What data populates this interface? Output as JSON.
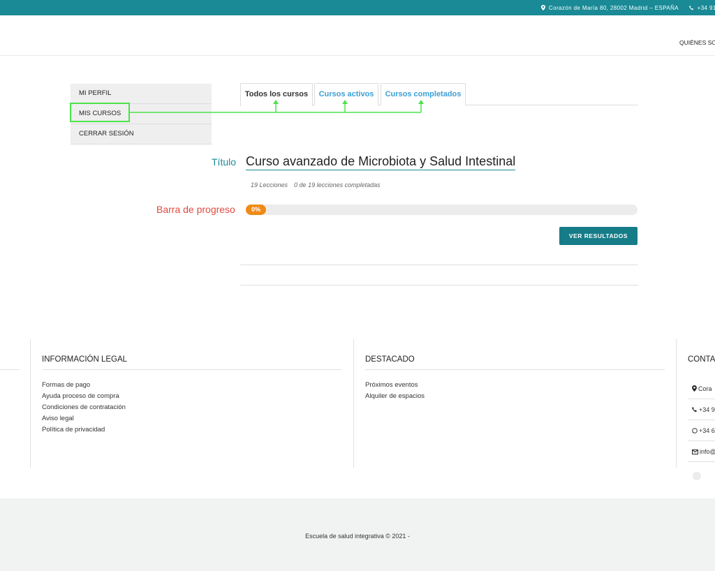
{
  "topbar": {
    "address": "Corazón de María 80, 28002 Madrid – ESPAÑA",
    "phone": "+34 91",
    "address_icon": "map-marker-icon",
    "phone_icon": "phone-icon",
    "background": "#1a8a96"
  },
  "header": {
    "nav_item": "QUIÉNES SO"
  },
  "sidebar": {
    "items": [
      {
        "label": "MI PERFIL"
      },
      {
        "label": "MIS CURSOS"
      },
      {
        "label": "CERRAR SESIÓN"
      }
    ]
  },
  "tabs": [
    {
      "label": "Todos los cursos",
      "active": true
    },
    {
      "label": "Cursos activos",
      "active": false
    },
    {
      "label": "Cursos completados",
      "active": false
    }
  ],
  "annotations": {
    "titulo": "Título",
    "barra": "Barra de progreso",
    "arrow_color": "#4be34b"
  },
  "course": {
    "title": "Curso avanzado de Microbiota y Salud Intestinal",
    "lessons": "19 Lecciones",
    "completed": "0 de 19 lecciones completadas",
    "progress_label": "0%",
    "progress_value": 0,
    "results_button": "VER RESULTADOS"
  },
  "footer": {
    "legal": {
      "heading": "INFORMACIÓN LEGAL",
      "links": [
        "Formas de pago",
        "Ayuda proceso de compra",
        "Condiciones de contratación",
        "Aviso legal",
        "Política de privacidad"
      ]
    },
    "featured": {
      "heading": "DESTACADO",
      "links": [
        "Próximos eventos",
        "Alquiler de espacios"
      ]
    },
    "contact": {
      "heading": "CONTA",
      "rows": [
        {
          "icon": "map-marker-icon",
          "text": "Cora"
        },
        {
          "icon": "phone-icon",
          "text": "+34 9"
        },
        {
          "icon": "whatsapp-icon",
          "text": "+34 6"
        },
        {
          "icon": "envelope-icon",
          "text": "info@"
        }
      ]
    },
    "copyright": "Escuela de salud integrativa © 2021 -"
  }
}
